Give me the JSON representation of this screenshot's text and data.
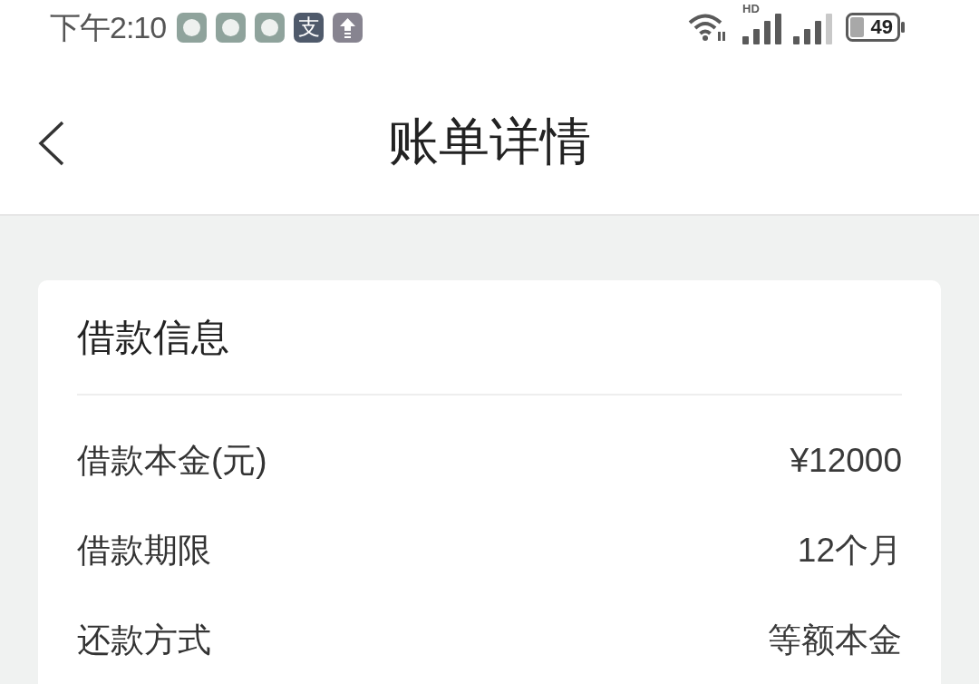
{
  "status_bar": {
    "time": "下午2:10",
    "notification_icons": [
      {
        "kind": "bubble"
      },
      {
        "kind": "bubble"
      },
      {
        "kind": "bubble"
      },
      {
        "kind": "glyph",
        "glyph": "支"
      },
      {
        "kind": "upload"
      }
    ],
    "network_label": "HD",
    "battery": "49"
  },
  "nav_bar": {
    "title": "账单详情"
  },
  "card": {
    "title": "借款信息",
    "rows": [
      {
        "label": "借款本金(元)",
        "value": "¥12000"
      },
      {
        "label": "借款期限",
        "value": "12个月"
      },
      {
        "label": "还款方式",
        "value": "等额本金"
      }
    ]
  }
}
